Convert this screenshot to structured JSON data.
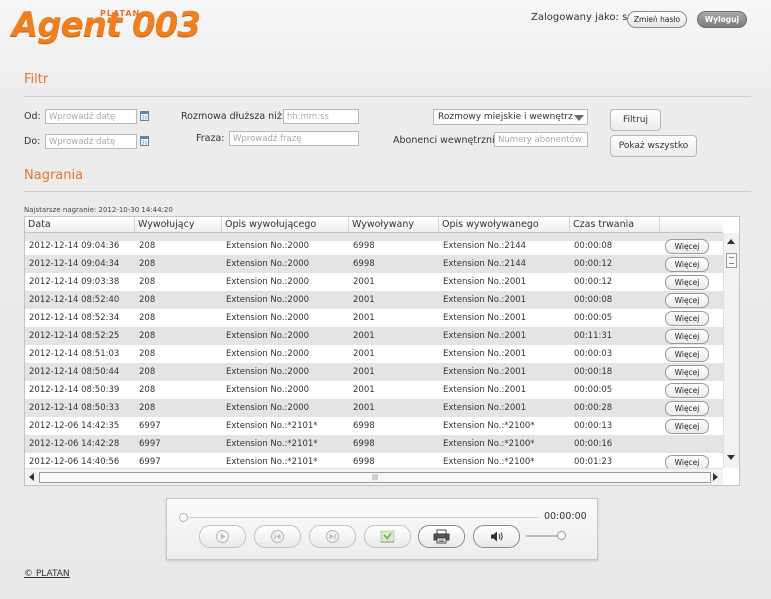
{
  "header": {
    "logo_small": "PLATAN",
    "logo_main": "Agent 003",
    "logged_in_label": "Zalogowany jako:  su",
    "change_password": "Zmień hasło",
    "logout": "Wyloguj"
  },
  "filter": {
    "title": "Filtr",
    "from_label": "Od:",
    "to_label": "Do:",
    "date_placeholder": "Wprowadź datę",
    "longer_label": "Rozmowa dłuższa niż:",
    "time_placeholder": "hh:mm:ss",
    "phrase_label": "Fraza:",
    "phrase_placeholder": "Wprowadź frazę",
    "call_type": "Rozmowy miejskie i wewnętrz",
    "internal_label": "Abonenci wewnętrzni:",
    "internal_placeholder": "Numery abonentów",
    "filter_button": "Filtruj",
    "show_all_button": "Pokaż wszystko"
  },
  "recordings": {
    "title": "Nagrania",
    "oldest": "Najstarsze nagranie: 2012-10-30 14:44:20",
    "columns": [
      "Data",
      "Wywołujący",
      "Opis wywołującego",
      "Wywoływany",
      "Opis wywoływanego",
      "Czas trwania"
    ],
    "more_label": "Więcej",
    "rows": [
      {
        "date": "2012-12-14 09:04:36",
        "caller": "208",
        "caller_desc": "Extension No.:2000",
        "callee": "6998",
        "callee_desc": "Extension No.:2144",
        "duration": "00:00:08",
        "more": true
      },
      {
        "date": "2012-12-14 09:04:34",
        "caller": "208",
        "caller_desc": "Extension No.:2000",
        "callee": "6998",
        "callee_desc": "Extension No.:2144",
        "duration": "00:00:12",
        "more": true
      },
      {
        "date": "2012-12-14 09:03:38",
        "caller": "208",
        "caller_desc": "Extension No.:2000",
        "callee": "2001",
        "callee_desc": "Extension No.:2001",
        "duration": "00:00:12",
        "more": true
      },
      {
        "date": "2012-12-14 08:52:40",
        "caller": "208",
        "caller_desc": "Extension No.:2000",
        "callee": "2001",
        "callee_desc": "Extension No.:2001",
        "duration": "00:00:08",
        "more": true
      },
      {
        "date": "2012-12-14 08:52:34",
        "caller": "208",
        "caller_desc": "Extension No.:2000",
        "callee": "2001",
        "callee_desc": "Extension No.:2001",
        "duration": "00:00:05",
        "more": true
      },
      {
        "date": "2012-12-14 08:52:25",
        "caller": "208",
        "caller_desc": "Extension No.:2000",
        "callee": "2001",
        "callee_desc": "Extension No.:2001",
        "duration": "00:11:31",
        "more": true
      },
      {
        "date": "2012-12-14 08:51:03",
        "caller": "208",
        "caller_desc": "Extension No.:2000",
        "callee": "2001",
        "callee_desc": "Extension No.:2001",
        "duration": "00:00:03",
        "more": true
      },
      {
        "date": "2012-12-14 08:50:44",
        "caller": "208",
        "caller_desc": "Extension No.:2000",
        "callee": "2001",
        "callee_desc": "Extension No.:2001",
        "duration": "00:00:18",
        "more": true
      },
      {
        "date": "2012-12-14 08:50:39",
        "caller": "208",
        "caller_desc": "Extension No.:2000",
        "callee": "2001",
        "callee_desc": "Extension No.:2001",
        "duration": "00:00:05",
        "more": true
      },
      {
        "date": "2012-12-14 08:50:33",
        "caller": "208",
        "caller_desc": "Extension No.:2000",
        "callee": "2001",
        "callee_desc": "Extension No.:2001",
        "duration": "00:00:28",
        "more": true
      },
      {
        "date": "2012-12-06 14:42:35",
        "caller": "6997",
        "caller_desc": "Extension No.:*2101*",
        "callee": "6998",
        "callee_desc": "Extension No.:*2100*",
        "duration": "00:00:13",
        "more": true
      },
      {
        "date": "2012-12-06 14:42:28",
        "caller": "6997",
        "caller_desc": "Extension No.:*2101*",
        "callee": "6998",
        "callee_desc": "Extension No.:*2100*",
        "duration": "00:00:16",
        "more": false
      },
      {
        "date": "2012-12-06 14:40:56",
        "caller": "6997",
        "caller_desc": "Extension No.:*2101*",
        "callee": "6998",
        "callee_desc": "Extension No.:*2100*",
        "duration": "00:01:23",
        "more": true
      }
    ],
    "hscroll_grip": "|||"
  },
  "player": {
    "time": "00:00:00",
    "buttons": [
      "play-icon",
      "skip-back-icon",
      "skip-forward-icon",
      "download-icon",
      "print-icon",
      "volume-icon"
    ],
    "progress_fraction": 0,
    "volume_fraction": 1
  },
  "footer": {
    "copyright": "© PLATAN"
  },
  "colors": {
    "accent": "#f07f1f",
    "row_alt": "#e4e4e4"
  }
}
